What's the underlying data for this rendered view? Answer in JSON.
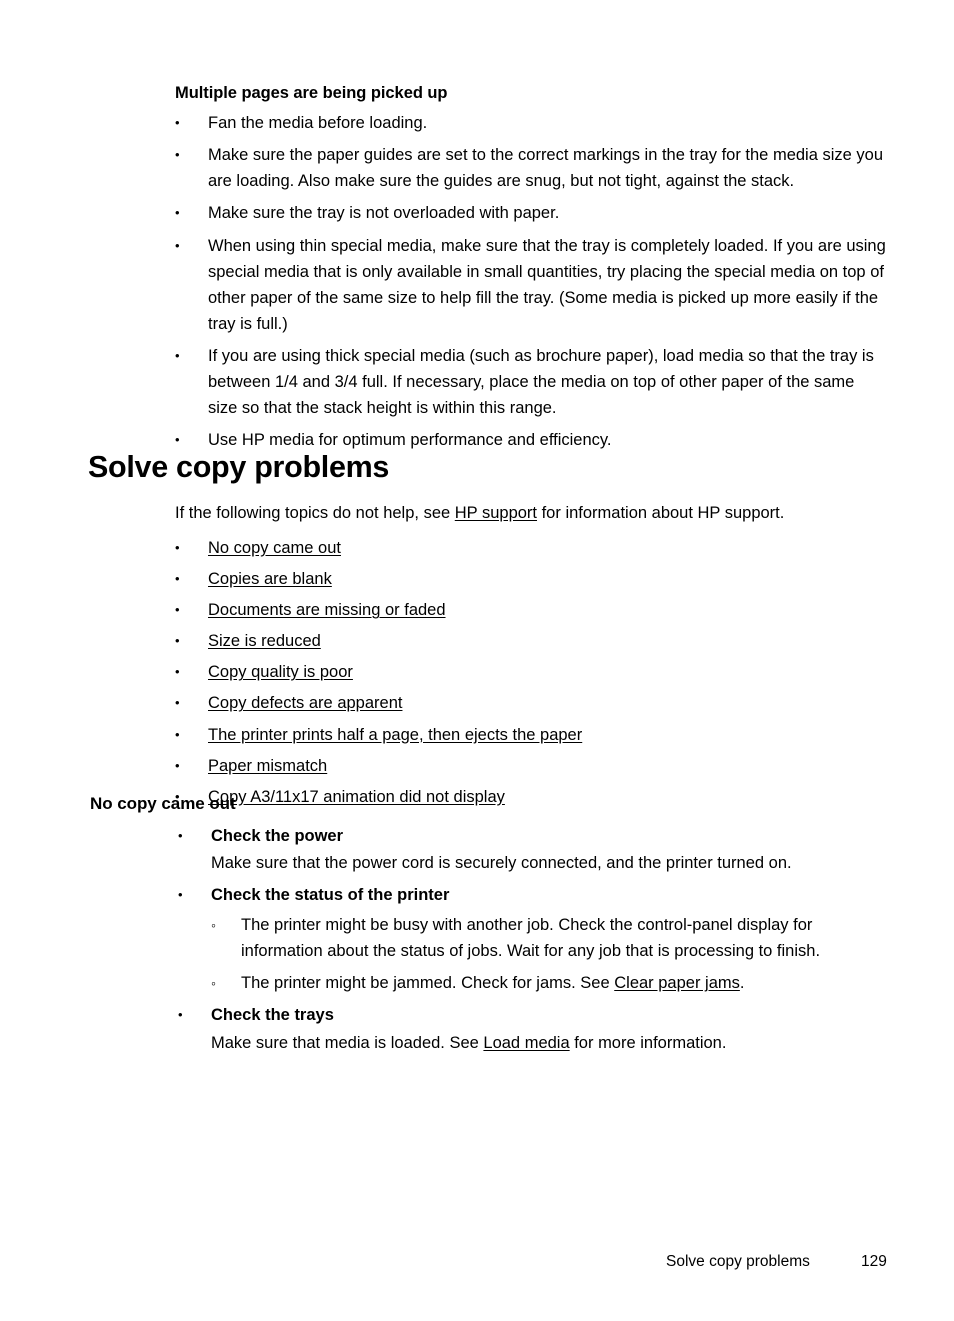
{
  "document": {
    "section_multiple_pages": {
      "heading": "Multiple pages are being picked up",
      "bullets": [
        "Fan the media before loading.",
        "Make sure the paper guides are set to the correct markings in the tray for the media size you are loading. Also make sure the guides are snug, but not tight, against the stack.",
        "Make sure the tray is not overloaded with paper.",
        "When using thin special media, make sure that the tray is completely loaded. If you are using special media that is only available in small quantities, try placing the special media on top of other paper of the same size to help fill the tray. (Some media is picked up more easily if the tray is full.)",
        "If you are using thick special media (such as brochure paper), load media so that the tray is between 1/4 and 3/4 full. If necessary, place the media on top of other paper of the same size so that the stack height is within this range.",
        "Use HP media for optimum performance and efficiency."
      ]
    },
    "section_solve_copy": {
      "heading": "Solve copy problems",
      "intro_before_link": "If the following topics do not help, see ",
      "intro_link": "HP support",
      "intro_after_link": " for information about HP support.",
      "links": [
        "No copy came out",
        "Copies are blank",
        "Documents are missing or faded",
        "Size is reduced",
        "Copy quality is poor",
        "Copy defects are apparent",
        "The printer prints half a page, then ejects the paper",
        "Paper mismatch",
        "Copy A3/11x17 animation did not display"
      ]
    },
    "section_no_copy": {
      "heading": "No copy came out",
      "items": [
        {
          "title": "Check the power",
          "body": "Make sure that the power cord is securely connected, and the printer turned on."
        },
        {
          "title": "Check the status of the printer",
          "subitems": [
            {
              "text": "The printer might be busy with another job. Check the control-panel display for information about the status of jobs. Wait for any job that is processing to finish."
            },
            {
              "text_before_link": "The printer might be jammed. Check for jams. See ",
              "link": "Clear paper jams",
              "text_after_link": "."
            }
          ]
        },
        {
          "title": "Check the trays",
          "body_before_link": "Make sure that media is loaded. See ",
          "body_link": "Load media",
          "body_after_link": " for more information."
        }
      ]
    }
  },
  "footer": {
    "title": "Solve copy problems",
    "page_number": "129"
  }
}
